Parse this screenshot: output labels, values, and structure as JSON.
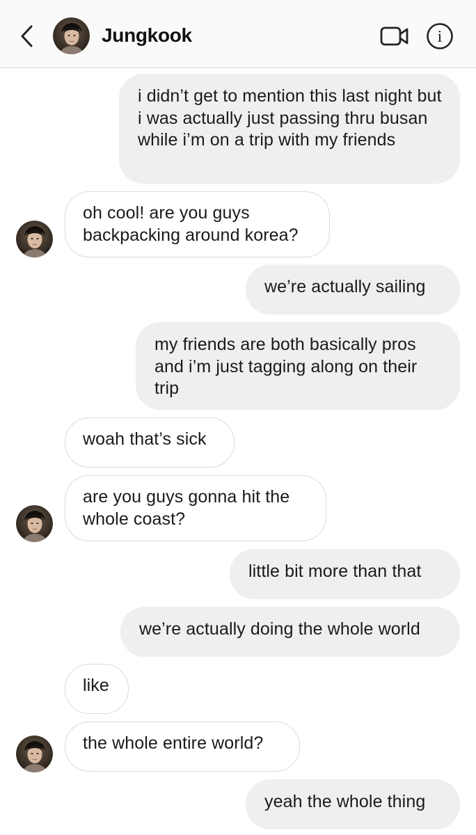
{
  "header": {
    "contact_name": "Jungkook",
    "back_icon": "chevron-left-icon",
    "video_icon": "video-camera-icon",
    "info_icon": "info-icon",
    "info_glyph": "i"
  },
  "colors": {
    "header_bg": "#fafafa",
    "outgoing_bubble": "#efefef",
    "incoming_bubble_border": "#dbdbdb",
    "text": "#1a1a1a"
  },
  "messages": [
    {
      "sender": "me",
      "text": "i didn’t get to mention this last night but i was actually just passing thru busan while i’m on a trip with my friends"
    },
    {
      "sender": "them",
      "text": "oh cool! are you guys backpacking around korea?",
      "show_avatar": true
    },
    {
      "sender": "me",
      "text": "we’re actually sailing"
    },
    {
      "sender": "me",
      "text": "my friends are both basically pros and i’m just tagging along on their trip"
    },
    {
      "sender": "them",
      "text": "woah that’s sick",
      "show_avatar": false
    },
    {
      "sender": "them",
      "text": "are you guys gonna hit the whole coast?",
      "show_avatar": true
    },
    {
      "sender": "me",
      "text": "little bit more than that"
    },
    {
      "sender": "me",
      "text": "we’re actually doing the whole world"
    },
    {
      "sender": "them",
      "text": "like",
      "show_avatar": false
    },
    {
      "sender": "them",
      "text": "the whole entire world?",
      "show_avatar": true
    },
    {
      "sender": "me",
      "text": "yeah the whole thing"
    }
  ]
}
